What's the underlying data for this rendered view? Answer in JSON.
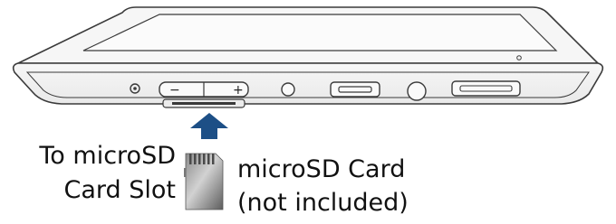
{
  "labels": {
    "slot_line1": "To microSD",
    "slot_line2": "Card Slot",
    "card_line1": "microSD Card",
    "card_line2": "(not included)"
  },
  "buttons": {
    "minus_symbol": "−",
    "plus_symbol": "+"
  },
  "colors": {
    "arrow": "#1d4f86",
    "device_fill": "#f4f4f4",
    "outline": "#3a3a3a",
    "card_dark": "#6e6e6e",
    "card_light": "#c9c9c9"
  }
}
